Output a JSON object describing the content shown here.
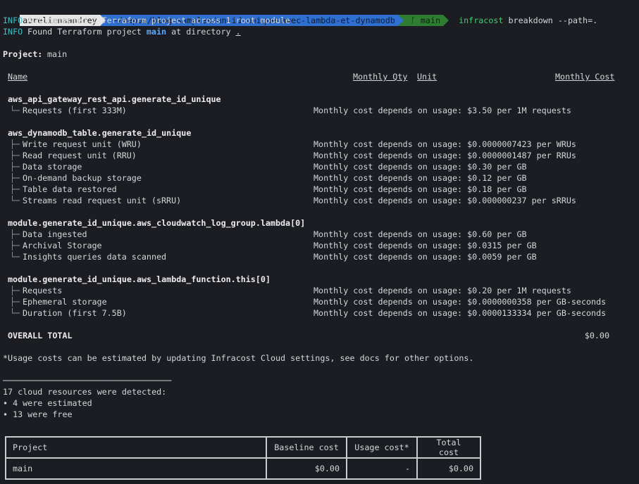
{
  "prompt": {
    "user": "aurelienaandrey",
    "path": "~/repos/blog-samples/un-id-unique-avec-lambda-et-dynamodb",
    "branch_icon": "git-branch-icon",
    "branch": "main",
    "command_name": "infracost",
    "command_args": "breakdown --path=."
  },
  "log": [
    {
      "level": "INFO",
      "text": "Autodetected 1 Terraform project across 1 root module"
    },
    {
      "level": "INFO",
      "text_before": "Found Terraform project ",
      "highlight": "main",
      "text_middle": " at directory ",
      "dir": "."
    }
  ],
  "project_line": {
    "label": "Project:",
    "value": "main"
  },
  "columns": {
    "name": "Name",
    "qty": "Monthly Qty",
    "unit": "Unit",
    "cost": "Monthly Cost"
  },
  "resources": [
    {
      "name": "aws_api_gateway_rest_api.generate_id_unique",
      "items": [
        {
          "tree": "└─",
          "label": "Requests (first 333M)",
          "cost": "Monthly cost depends on usage: $3.50 per 1M requests"
        }
      ]
    },
    {
      "name": "aws_dynamodb_table.generate_id_unique",
      "items": [
        {
          "tree": "├─",
          "label": "Write request unit (WRU)",
          "cost": "Monthly cost depends on usage: $0.0000007423 per WRUs"
        },
        {
          "tree": "├─",
          "label": "Read request unit (RRU)",
          "cost": "Monthly cost depends on usage: $0.0000001487 per RRUs"
        },
        {
          "tree": "├─",
          "label": "Data storage",
          "cost": "Monthly cost depends on usage: $0.30 per GB"
        },
        {
          "tree": "├─",
          "label": "On-demand backup storage",
          "cost": "Monthly cost depends on usage: $0.12 per GB"
        },
        {
          "tree": "├─",
          "label": "Table data restored",
          "cost": "Monthly cost depends on usage: $0.18 per GB"
        },
        {
          "tree": "└─",
          "label": "Streams read request unit (sRRU)",
          "cost": "Monthly cost depends on usage: $0.000000237 per sRRUs"
        }
      ]
    },
    {
      "name": "module.generate_id_unique.aws_cloudwatch_log_group.lambda[0]",
      "items": [
        {
          "tree": "├─",
          "label": "Data ingested",
          "cost": "Monthly cost depends on usage: $0.60 per GB"
        },
        {
          "tree": "├─",
          "label": "Archival Storage",
          "cost": "Monthly cost depends on usage: $0.0315 per GB"
        },
        {
          "tree": "└─",
          "label": "Insights queries data scanned",
          "cost": "Monthly cost depends on usage: $0.0059 per GB"
        }
      ]
    },
    {
      "name": "module.generate_id_unique.aws_lambda_function.this[0]",
      "items": [
        {
          "tree": "├─",
          "label": "Requests",
          "cost": "Monthly cost depends on usage: $0.20 per 1M requests"
        },
        {
          "tree": "├─",
          "label": "Ephemeral storage",
          "cost": "Monthly cost depends on usage: $0.0000000358 per GB-seconds"
        },
        {
          "tree": "└─",
          "label": "Duration (first 7.5B)",
          "cost": "Monthly cost depends on usage: $0.0000133334 per GB-seconds"
        }
      ]
    }
  ],
  "overall": {
    "label": "OVERALL TOTAL",
    "value": "$0.00"
  },
  "note": "*Usage costs can be estimated by updating Infracost Cloud settings, see docs for other options.",
  "separator": "──────────────────────────────────",
  "detected": {
    "summary": "17 cloud resources were detected:",
    "lines": [
      "∙ 4 were estimated",
      "∙ 13 were free"
    ]
  },
  "summary_table": {
    "headers": [
      "Project",
      "Baseline cost",
      "Usage cost*",
      "Total cost"
    ],
    "rows": [
      [
        "main",
        "$0.00",
        "-",
        "$0.00"
      ]
    ]
  }
}
